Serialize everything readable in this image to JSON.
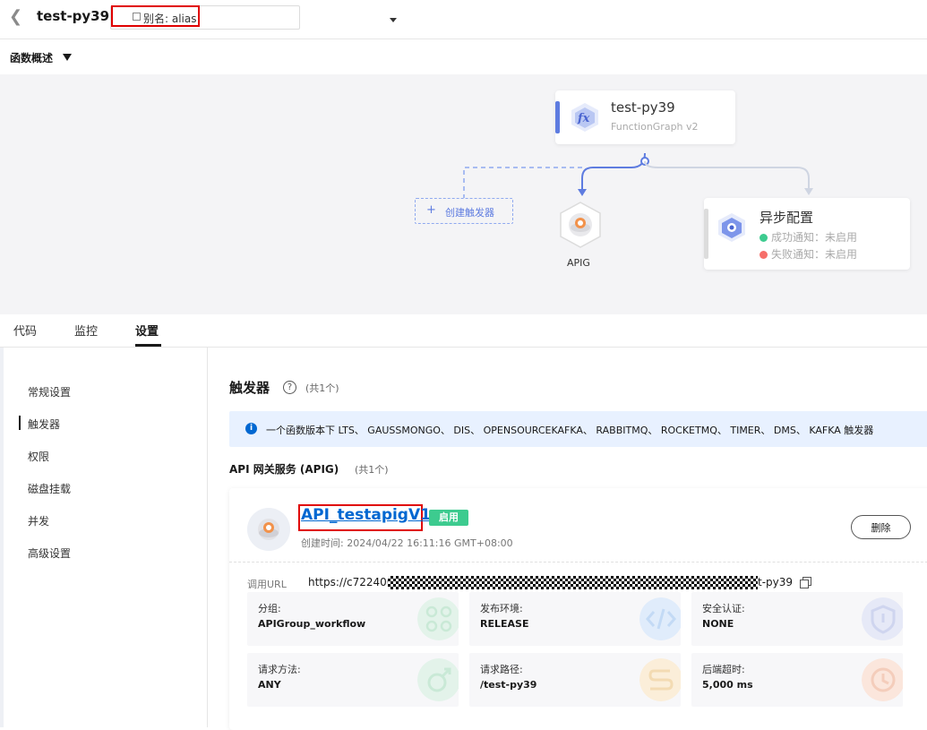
{
  "header": {
    "back_icon": "chevron-left-icon",
    "function_name": "test-py39",
    "alias_prefix": "别名: alias"
  },
  "overview": {
    "label": "函数概述"
  },
  "diagram": {
    "function_node": {
      "name": "test-py39",
      "runtime": "FunctionGraph v2",
      "icon": "fx-icon"
    },
    "create_trigger": {
      "plus": "+",
      "label": "创建触发器"
    },
    "apig_node": {
      "label": "APIG"
    },
    "async_node": {
      "title": "异步配置",
      "success": "成功通知：未启用",
      "failure": "失败通知：未启用",
      "success_color": "#3dcb8f",
      "failure_color": "#f66f6a"
    }
  },
  "tabs": [
    {
      "label": "代码"
    },
    {
      "label": "监控"
    },
    {
      "label": "设置"
    }
  ],
  "sidenav": [
    {
      "label": "常规设置"
    },
    {
      "label": "触发器"
    },
    {
      "label": "权限"
    },
    {
      "label": "磁盘挂载"
    },
    {
      "label": "并发"
    },
    {
      "label": "高级设置"
    }
  ],
  "triggers": {
    "title": "触发器",
    "help": "?",
    "count": "(共1个)",
    "info_icon": "i",
    "info": "一个函数版本下 LTS、 GAUSSMONGO、 DIS、 OPENSOURCEKAFKA、 RABBITMQ、 ROCKETMQ、 TIMER、 DMS、 KAFKA 触发器",
    "apig_title": "API 网关服务 (APIG)",
    "apig_count": "(共1个)"
  },
  "api_card": {
    "name": "API_testapigV1",
    "status": "启用",
    "created": "创建时间:   2024/04/22 16:11:16 GMT+08:00",
    "delete_label": "删除",
    "url_label": "调用URL",
    "url_start": "https://c722406",
    "url_end": "t-py39",
    "tiles": [
      {
        "key": "分组:",
        "value": "APIGroup_workflow",
        "icon": "group-icon"
      },
      {
        "key": "发布环境:",
        "value": "RELEASE",
        "icon": "code-icon"
      },
      {
        "key": "安全认证:",
        "value": "NONE",
        "icon": "shield-icon"
      },
      {
        "key": "请求方法:",
        "value": "ANY",
        "icon": "method-icon"
      },
      {
        "key": "请求路径:",
        "value": "/test-py39",
        "icon": "path-icon"
      },
      {
        "key": "后端超时:",
        "value": "5,000 ms",
        "icon": "clock-icon"
      }
    ]
  }
}
